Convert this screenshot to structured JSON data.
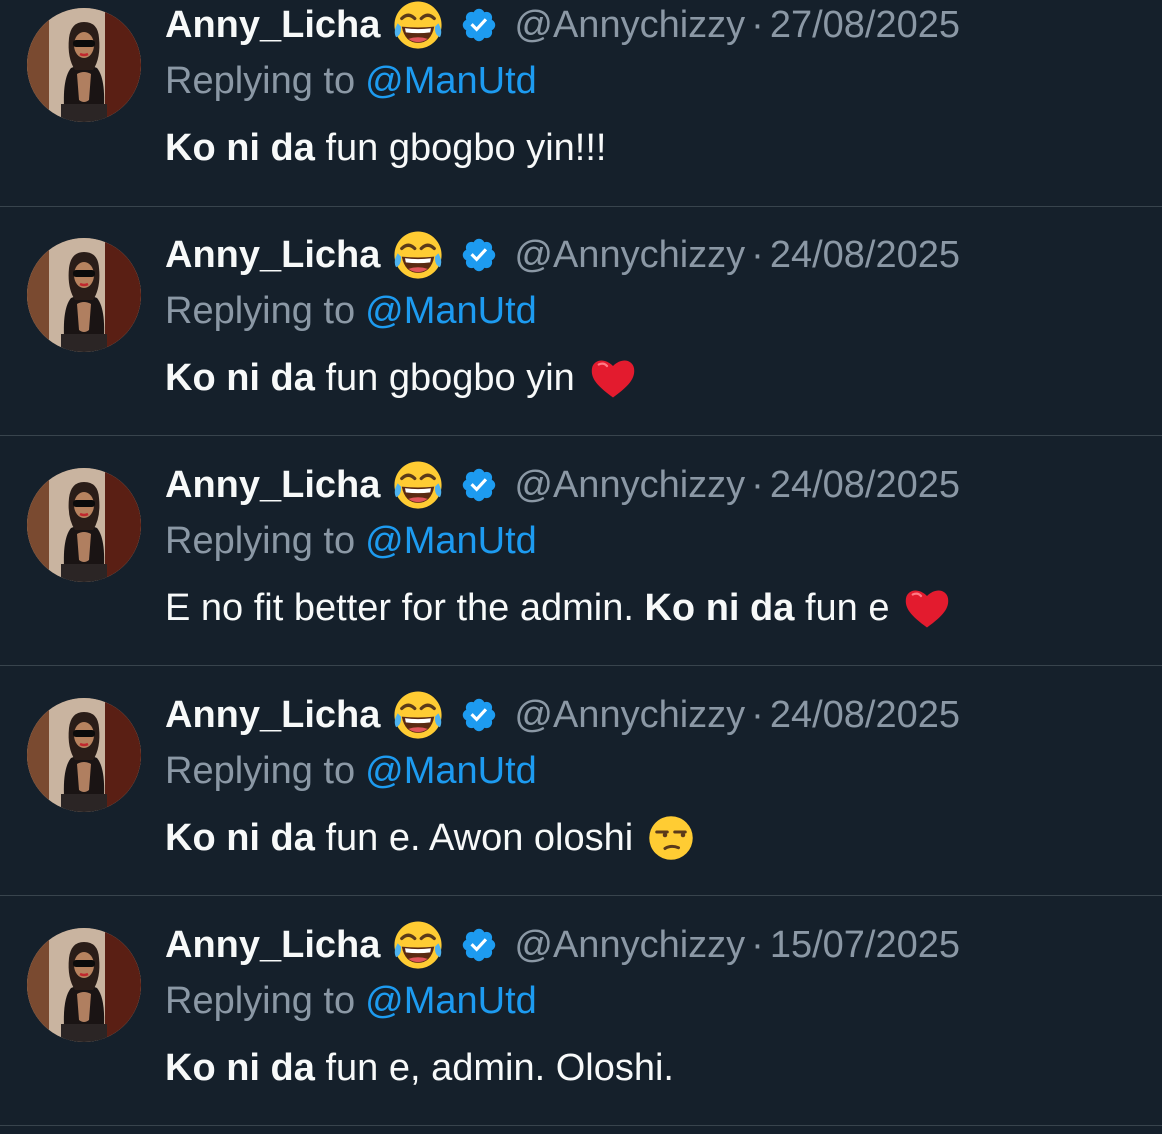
{
  "tweets": [
    {
      "display_name": "Anny_Licha",
      "handle": "@Annychizzy",
      "separator": "·",
      "date": "27/08/2025",
      "replying_prefix": "Replying to",
      "replying_to": "@ManUtd",
      "text_bold": "Ko ni da",
      "text_rest": "fun gbogbo yin!!!",
      "text_tail_emoji": "none"
    },
    {
      "display_name": "Anny_Licha",
      "handle": "@Annychizzy",
      "separator": "·",
      "date": "24/08/2025",
      "replying_prefix": "Replying to",
      "replying_to": "@ManUtd",
      "text_bold": "Ko ni da",
      "text_rest": "fun gbogbo yin",
      "text_tail_emoji": "red-heart"
    },
    {
      "display_name": "Anny_Licha",
      "handle": "@Annychizzy",
      "separator": "·",
      "date": "24/08/2025",
      "replying_prefix": "Replying to",
      "replying_to": "@ManUtd",
      "text_lead": "E no fit better for the admin.",
      "text_bold": "Ko ni da",
      "text_rest": "fun e",
      "text_tail_emoji": "red-heart"
    },
    {
      "display_name": "Anny_Licha",
      "handle": "@Annychizzy",
      "separator": "·",
      "date": "24/08/2025",
      "replying_prefix": "Replying to",
      "replying_to": "@ManUtd",
      "text_bold": "Ko ni da",
      "text_rest": "fun e. Awon oloshi",
      "text_tail_emoji": "unamused-face"
    },
    {
      "display_name": "Anny_Licha",
      "handle": "@Annychizzy",
      "separator": "·",
      "date": "15/07/2025",
      "replying_prefix": "Replying to",
      "replying_to": "@ManUtd",
      "text_bold": "Ko ni da",
      "text_rest": "fun e, admin. Oloshi.",
      "text_tail_emoji": "none"
    }
  ],
  "icons": {
    "name_emoji": "face-with-tears-of-joy",
    "verified_badge": "verified-badge"
  },
  "colors": {
    "background": "#15202b",
    "primary_text": "#f7f9f9",
    "secondary_text": "#8b98a5",
    "accent": "#1d9bf0",
    "divider": "#38444d"
  }
}
